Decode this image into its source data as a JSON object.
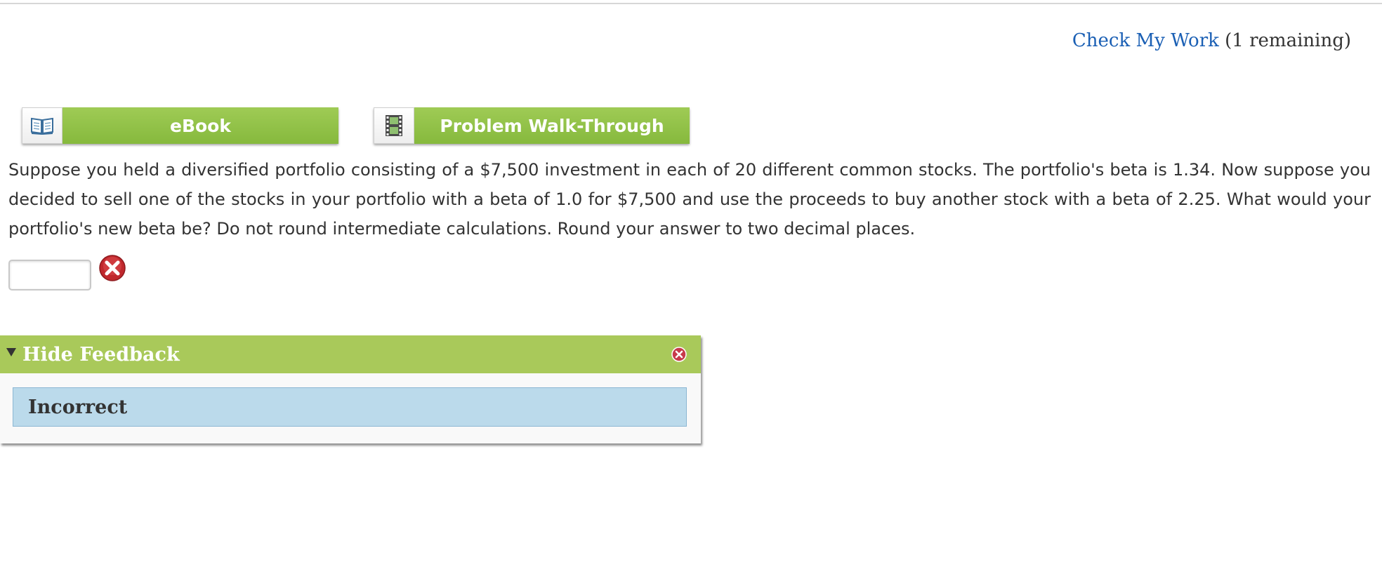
{
  "header": {
    "check_work_link": "Check My Work",
    "remaining": "(1 remaining)"
  },
  "toolbar": {
    "ebook_label": "eBook",
    "ebook_icon": "book-icon",
    "walkthrough_label": "Problem Walk-Through",
    "walkthrough_icon": "film-icon",
    "button_color": "#8dbf45"
  },
  "question": {
    "text": "Suppose you held a diversified portfolio consisting of a $7,500 investment in each of 20 different common stocks. The portfolio's beta is 1.34. Now suppose you decided to sell one of the stocks in your portfolio with a beta of 1.0 for $7,500 and use the proceeds to buy another stock with a beta of 2.25. What would your portfolio's new beta be? Do not round intermediate calculations. Round your answer to two decimal places."
  },
  "answer": {
    "value": "",
    "status_icon": "incorrect-x-icon"
  },
  "feedback": {
    "toggle_label": "Hide Feedback",
    "result": "Incorrect",
    "header_color": "#a9c95a",
    "body_color": "#bbdaeb"
  }
}
